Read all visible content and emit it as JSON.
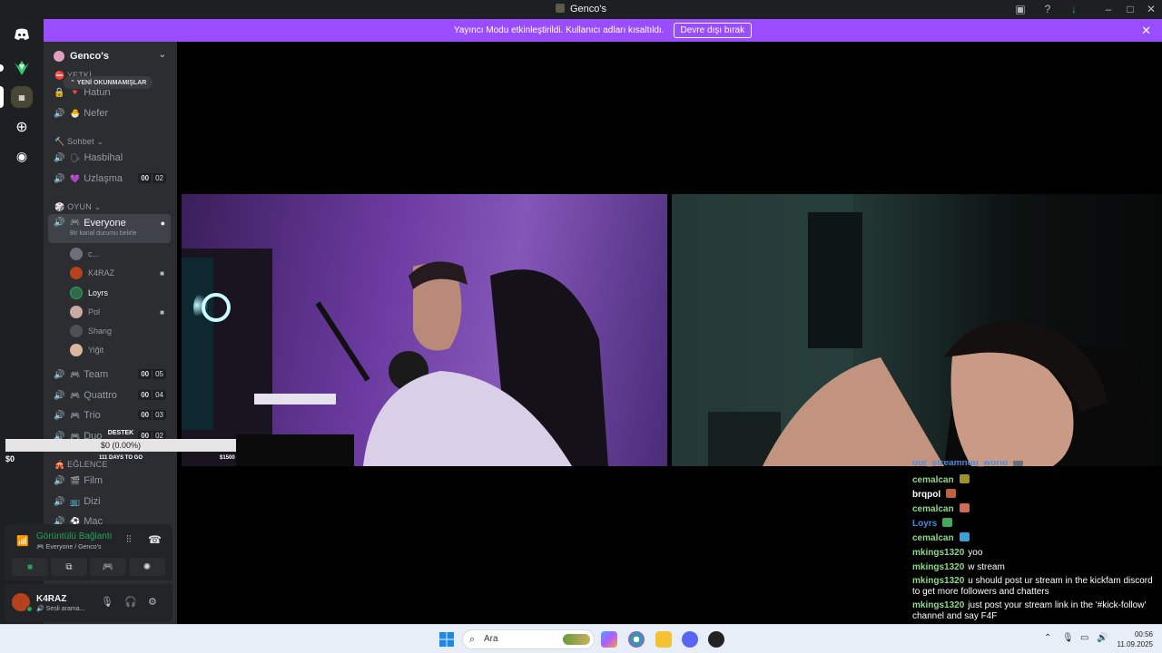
{
  "window": {
    "title": "Genco's"
  },
  "banner": {
    "text": "Yayıncı Modu etkinleştirildi. Kullanıcı adları kısaltıldı.",
    "button": "Devre dışı bırak"
  },
  "server": {
    "name": "Genco's",
    "unread_pill": "YENİ OKUNMAMIŞLAR",
    "top_categories": [
      {
        "label": "YETKİ"
      },
      {
        "label": "Hatun"
      },
      {
        "label": "Nefer"
      }
    ],
    "categories": [
      {
        "label": "Sohbet"
      },
      {
        "label": "OYUN"
      },
      {
        "label": "EĞLENCE"
      }
    ],
    "sohbet_channels": [
      {
        "name": "Hasbihal",
        "count": ""
      },
      {
        "name": "Uzlaşma",
        "count_a": "00",
        "count_b": "02"
      }
    ],
    "active_channel": {
      "name": "Everyone",
      "status": "Bir kanal durumu belirle"
    },
    "members": [
      {
        "name": "c...",
        "color": "#6d6f78",
        "cam": false
      },
      {
        "name": "K4RAZ",
        "color": "#b5421d",
        "cam": true
      },
      {
        "name": "Loyrs",
        "color": "#2f6b4a",
        "cam": false
      },
      {
        "name": "Pol",
        "color": "#c9a9a0",
        "cam": true
      },
      {
        "name": "Shang",
        "color": "#4e5058",
        "cam": false
      },
      {
        "name": "Yiğit",
        "color": "#d9b6a0",
        "cam": false
      }
    ],
    "oyun_channels": [
      {
        "name": "Team",
        "count_a": "00",
        "count_b": "05"
      },
      {
        "name": "Quattro",
        "count_a": "00",
        "count_b": "04"
      },
      {
        "name": "Trio",
        "count_a": "00",
        "count_b": "03"
      },
      {
        "name": "Duo",
        "count_a": "00",
        "count_b": "02"
      }
    ],
    "eglence_channels": [
      {
        "name": "Film"
      },
      {
        "name": "Dizi"
      },
      {
        "name": "Maç"
      }
    ]
  },
  "voice": {
    "status": "Görüntülü Bağlantı",
    "location": "Everyone / Genco's"
  },
  "user": {
    "name": "K4RAZ",
    "status": "Sesli arama..."
  },
  "donation": {
    "title": "DESTEK",
    "progress_text": "$0 (0.00%)",
    "progress": 0,
    "current": "$0",
    "countdown": "111 DAYS TO GO",
    "goal": "$1500"
  },
  "chat": [
    {
      "user": "our_streamhub_world",
      "text": "",
      "color": "#4e8ad8",
      "emote": "#6d6f78"
    },
    {
      "user": "cemalcan",
      "text": "",
      "color": "#8fd88a",
      "emote": "#a0902a"
    },
    {
      "user": "brqpol",
      "text": "",
      "color": "#ffffff",
      "emote": "#c06040"
    },
    {
      "user": "cemalcan",
      "text": "",
      "color": "#8fd88a",
      "emote": "#d06a50"
    },
    {
      "user": "Loyrs",
      "text": "",
      "color": "#4e8ad8",
      "emote": "#46a860"
    },
    {
      "user": "cemalcan",
      "text": "",
      "color": "#8fd88a",
      "emote": "#3aa0d8"
    },
    {
      "user": "mkings1320",
      "text": "yoo",
      "color": "#8fd88a"
    },
    {
      "user": "mkings1320",
      "text": "w stream",
      "color": "#8fd88a"
    },
    {
      "user": "mkings1320",
      "text": "u should post ur stream in the kickfam discord to get more followers and chatters",
      "color": "#8fd88a"
    },
    {
      "user": "mkings1320",
      "text": "just post your stream link in the '#kick-follow' channel and say F4F",
      "color": "#8fd88a"
    }
  ],
  "taskbar": {
    "search_placeholder": "Ara",
    "time": "00:56",
    "date": "11.09.2025"
  }
}
